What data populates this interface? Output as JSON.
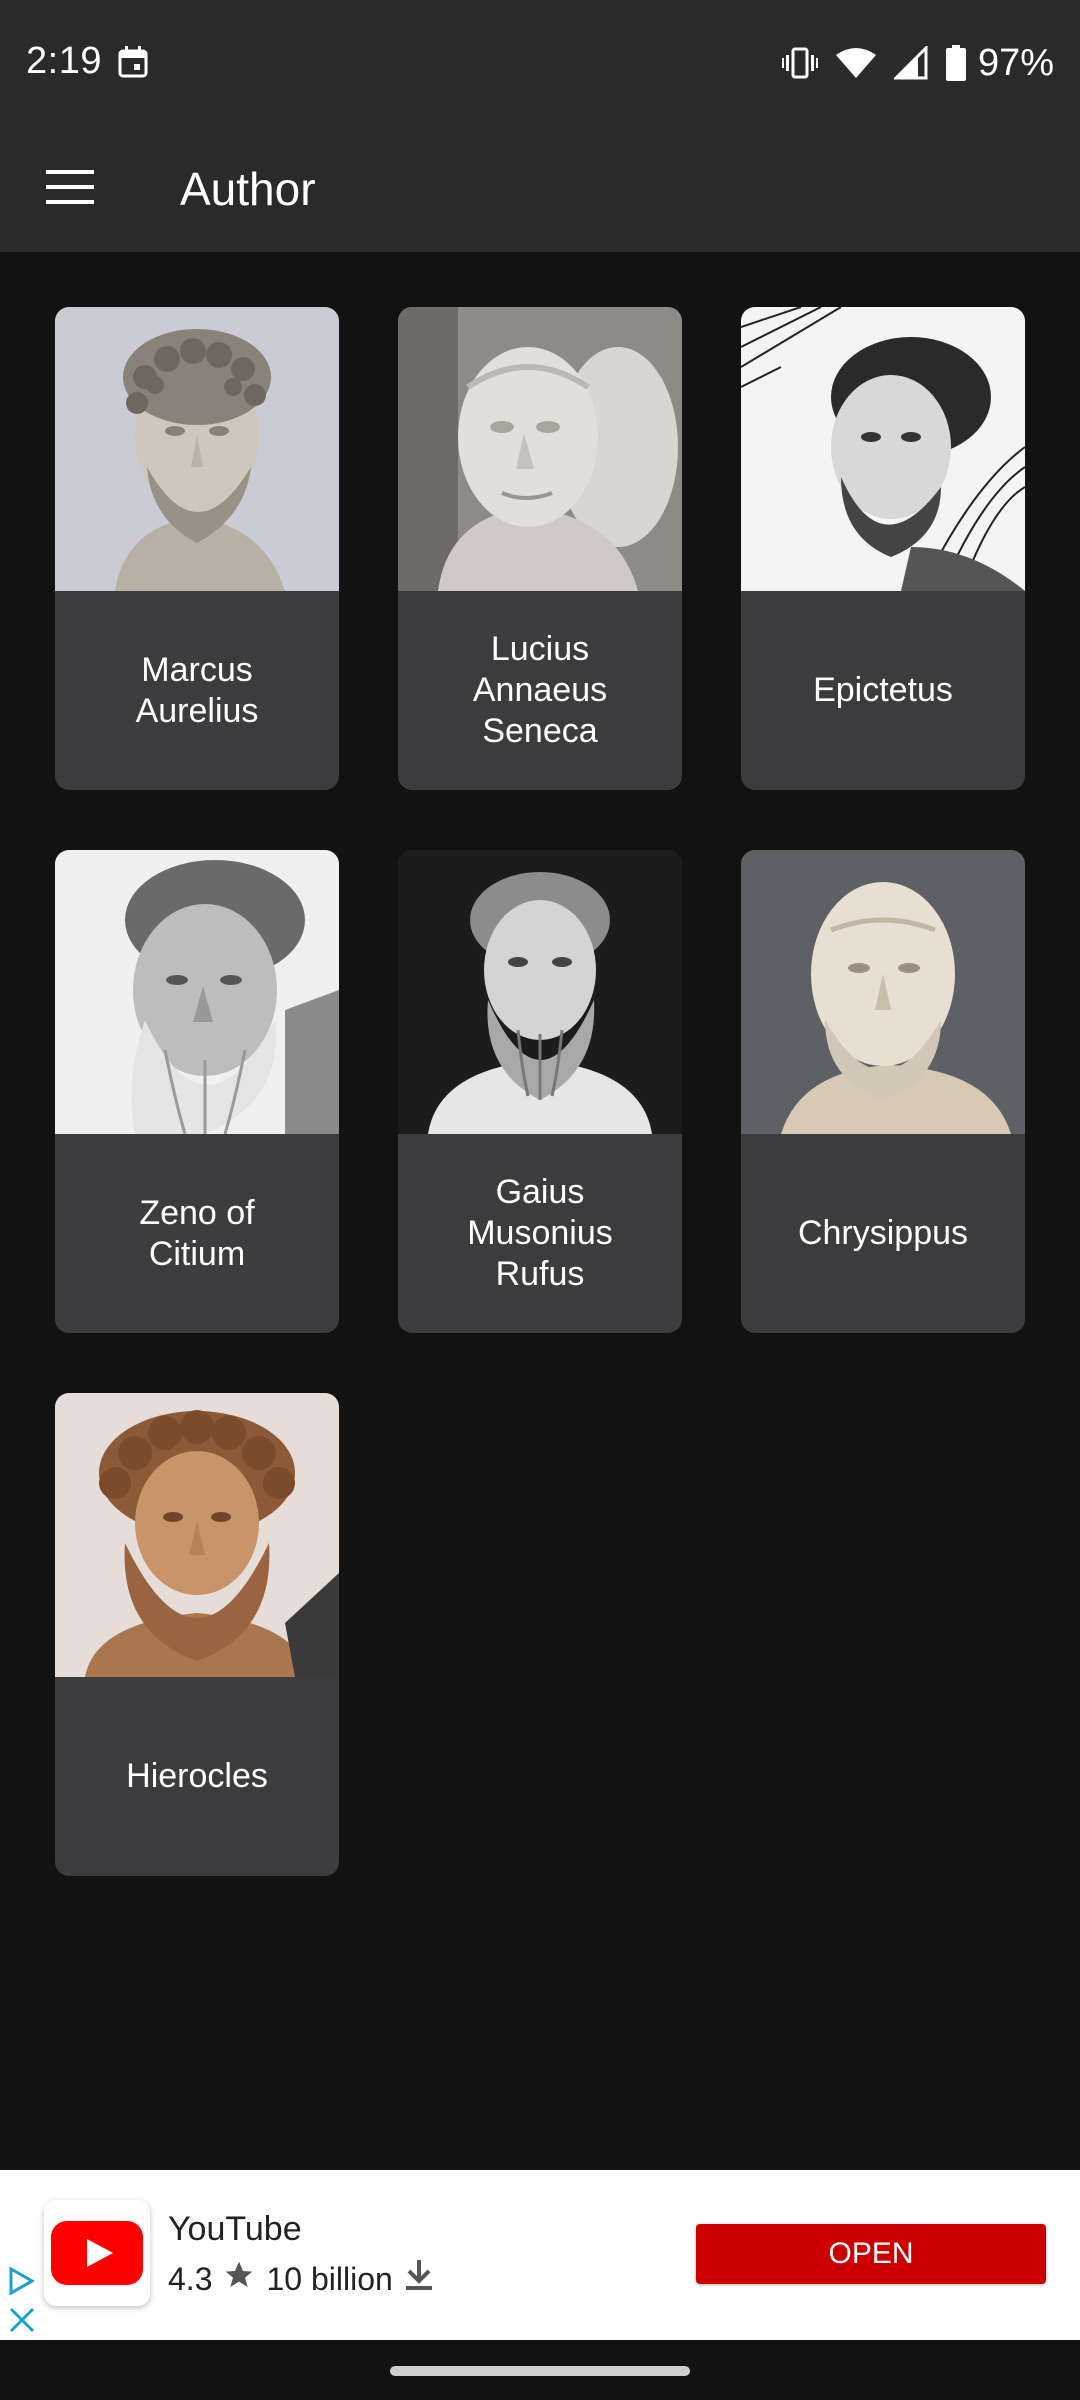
{
  "status_bar": {
    "time": "2:19",
    "battery": "97%",
    "icons": [
      "calendar-icon",
      "vibrate-icon",
      "wifi-icon",
      "signal-icon",
      "battery-icon"
    ]
  },
  "app_bar": {
    "title": "Author",
    "menu_icon": "hamburger-menu-icon"
  },
  "authors": [
    {
      "name": "Marcus\nAurelius",
      "image": "marcus-aurelius-bust"
    },
    {
      "name": "Lucius\nAnnaeus\nSeneca",
      "image": "seneca-bust"
    },
    {
      "name": "Epictetus",
      "image": "epictetus-engraving"
    },
    {
      "name": "Zeno of\nCitium",
      "image": "zeno-bust"
    },
    {
      "name": "Gaius\nMusonius\nRufus",
      "image": "musonius-rufus-engraving"
    },
    {
      "name": "Chrysippus",
      "image": "chrysippus-bust"
    },
    {
      "name": "Hierocles",
      "image": "hierocles-bust"
    }
  ],
  "ad": {
    "app_name": "YouTube",
    "rating": "4.3",
    "downloads": "10 billion",
    "cta": "OPEN",
    "accent_color": "#cc0000"
  },
  "colors": {
    "background": "#121212",
    "app_bar": "#2a2a2a",
    "card": "#3c3c3e"
  }
}
